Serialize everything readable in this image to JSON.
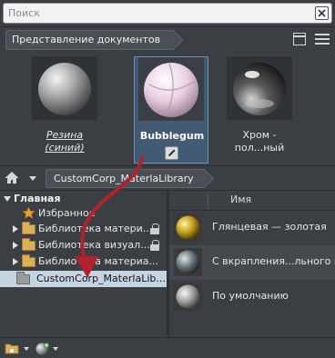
{
  "search": {
    "placeholder": "Поиск"
  },
  "doc_header": {
    "title": "Представление документов"
  },
  "doc_materials": [
    {
      "name_line1": "Резина",
      "name_line2": "(синий)"
    },
    {
      "name_line1": "Bubblegum",
      "name_line2": ""
    },
    {
      "name_line1": "Хром -",
      "name_line2": "пол...ный"
    }
  ],
  "library_bar": {
    "library": "CustomCorp_MaterlaLibrary"
  },
  "tree": {
    "root": "Главная",
    "items": [
      {
        "label": "Избранное"
      },
      {
        "label": "Библиотека матери..."
      },
      {
        "label": "Библиотека визуал..."
      },
      {
        "label": "Библиотека материа..."
      },
      {
        "label": "CustomCorp_MaterlaLib..."
      }
    ]
  },
  "list": {
    "column": "Имя",
    "rows": [
      {
        "label": "Глянцевая — золотая"
      },
      {
        "label": "С вкрапления...льного цв"
      },
      {
        "label": "По умолчанию"
      }
    ]
  },
  "colors": {
    "background": "#3b3f44",
    "selection": "#435a74",
    "tree_selection": "#c5d4e3",
    "arrow": "#b0232a"
  }
}
